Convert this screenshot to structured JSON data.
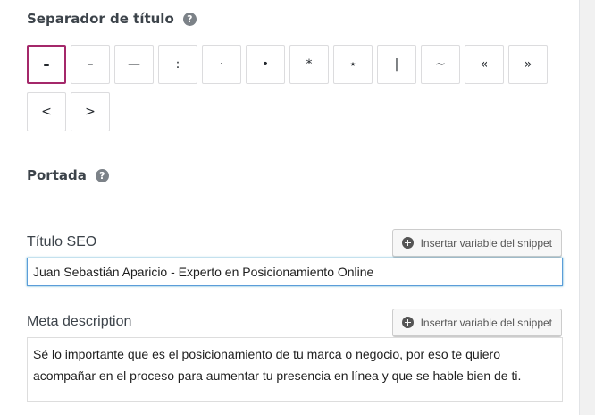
{
  "separator": {
    "title": "Separador de título",
    "help": "?",
    "options": [
      "-",
      "–",
      "—",
      ":",
      "·",
      "•",
      "*",
      "⋆",
      "|",
      "~",
      "«",
      "»",
      "<",
      ">"
    ],
    "selected_index": 0
  },
  "homepage": {
    "title": "Portada",
    "help": "?"
  },
  "seo_title": {
    "label": "Título SEO",
    "insert_button": "Insertar variable del snippet",
    "value": "Juan Sebastián Aparicio - Experto en Posicionamiento Online"
  },
  "meta_description": {
    "label": "Meta description",
    "insert_button": "Insertar variable del snippet",
    "value": "Sé lo importante que es el posicionamiento de tu marca o negocio, por eso te quiero acompañar en el proceso para aumentar tu presencia en línea y que se hable bien de ti."
  }
}
